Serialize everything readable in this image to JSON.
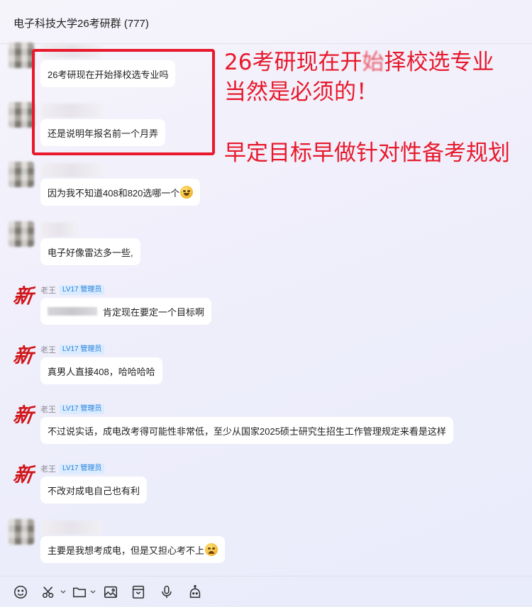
{
  "header": {
    "title": "电子科技大学26考研群 (777)"
  },
  "messages": [
    {
      "avatar": "blurred",
      "name": "",
      "badge": "",
      "text": "26考研现在开始择校选专业吗",
      "emoji": ""
    },
    {
      "avatar": "blurred",
      "name": "",
      "badge": "",
      "text": "还是说明年报名前一个月弄",
      "emoji": ""
    },
    {
      "avatar": "blurred",
      "name": "",
      "badge": "",
      "text": "因为我不知道408和820选哪一个",
      "emoji": "laughing-tears-emoji"
    },
    {
      "avatar": "blurred",
      "name": "",
      "badge": "",
      "text": "电子好像雷达多一些,",
      "emoji": ""
    },
    {
      "avatar": "xin-logo",
      "name": "老王",
      "badge": "LV17 管理员",
      "text": "肯定现在要定一个目标啊",
      "emoji": ""
    },
    {
      "avatar": "xin-logo",
      "name": "老王",
      "badge": "LV17 管理员",
      "text": "真男人直接408，哈哈哈哈",
      "emoji": ""
    },
    {
      "avatar": "xin-logo",
      "name": "老王",
      "badge": "LV17 管理员",
      "text": "不过说实话，成电改考得可能性非常低，至少从国家2025硕士研究生招生工作管理规定来看是这样",
      "emoji": ""
    },
    {
      "avatar": "xin-logo",
      "name": "老王",
      "badge": "LV17 管理员",
      "text": "不改对成电自己也有利",
      "emoji": ""
    },
    {
      "avatar": "blurred",
      "name": "",
      "badge": "",
      "text": "主要是我想考成电，但是又担心考不上",
      "emoji": "pleading-emoji"
    }
  ],
  "logo_char": "新",
  "annotation": {
    "line1_a": "26考研现在开",
    "line1_b": "始",
    "line1_c": "择校选专业",
    "line2": "当然是必须的！",
    "line3": "早定目标早做针对性备考规划",
    "color": "#e8192c"
  },
  "toolbar": {
    "icons": [
      "emoji-icon",
      "scissors-icon",
      "folder-icon",
      "image-icon",
      "chat-history-icon",
      "microphone-icon",
      "robot-icon"
    ]
  }
}
